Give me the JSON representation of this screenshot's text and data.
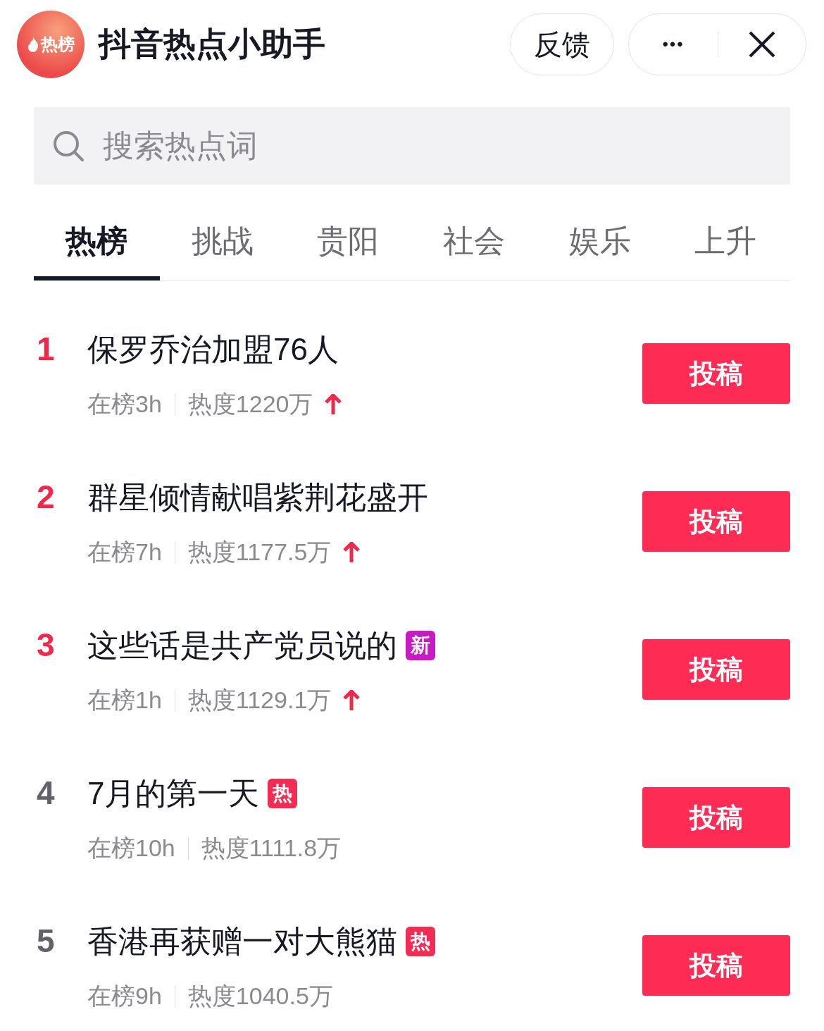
{
  "header": {
    "logo_text": "热榜",
    "title": "抖音热点小助手",
    "feedback_button": "反馈",
    "more_button": "•••"
  },
  "search": {
    "placeholder": "搜索热点词"
  },
  "tabs": [
    {
      "label": "热榜",
      "selected": true
    },
    {
      "label": "挑战",
      "selected": false
    },
    {
      "label": "贵阳",
      "selected": false
    },
    {
      "label": "社会",
      "selected": false
    },
    {
      "label": "娱乐",
      "selected": false
    },
    {
      "label": "上升",
      "selected": false
    }
  ],
  "items": [
    {
      "rank": "1",
      "color": "#f0284a",
      "title": "保罗乔治加盟76人",
      "time": "在榜3h",
      "heat": "热度1220万",
      "rising": true,
      "button": "投稿"
    },
    {
      "rank": "2",
      "color": "#f0284a",
      "title": "群星倾情献唱紫荆花盛开",
      "time": "在榜7h",
      "heat": "热度1177.5万",
      "rising": true,
      "button": "投稿"
    },
    {
      "rank": "3",
      "color": "#f0284a",
      "title": "这些话是共产党员说的",
      "badge": {
        "text": "新",
        "color": "#c81bc4"
      },
      "time": "在榜1h",
      "heat": "热度1129.1万",
      "rising": true,
      "button": "投稿"
    },
    {
      "rank": "4",
      "color": "#61626a",
      "title": "7月的第一天",
      "badge": {
        "text": "热",
        "color": "#f42c54"
      },
      "time": "在榜10h",
      "heat": "热度1111.8万",
      "rising": false,
      "button": "投稿"
    },
    {
      "rank": "5",
      "color": "#61626a",
      "title": "香港再获赠一对大熊猫",
      "badge": {
        "text": "热",
        "color": "#f42c54"
      },
      "time": "在榜9h",
      "heat": "热度1040.5万",
      "rising": false,
      "button": "投稿"
    }
  ]
}
